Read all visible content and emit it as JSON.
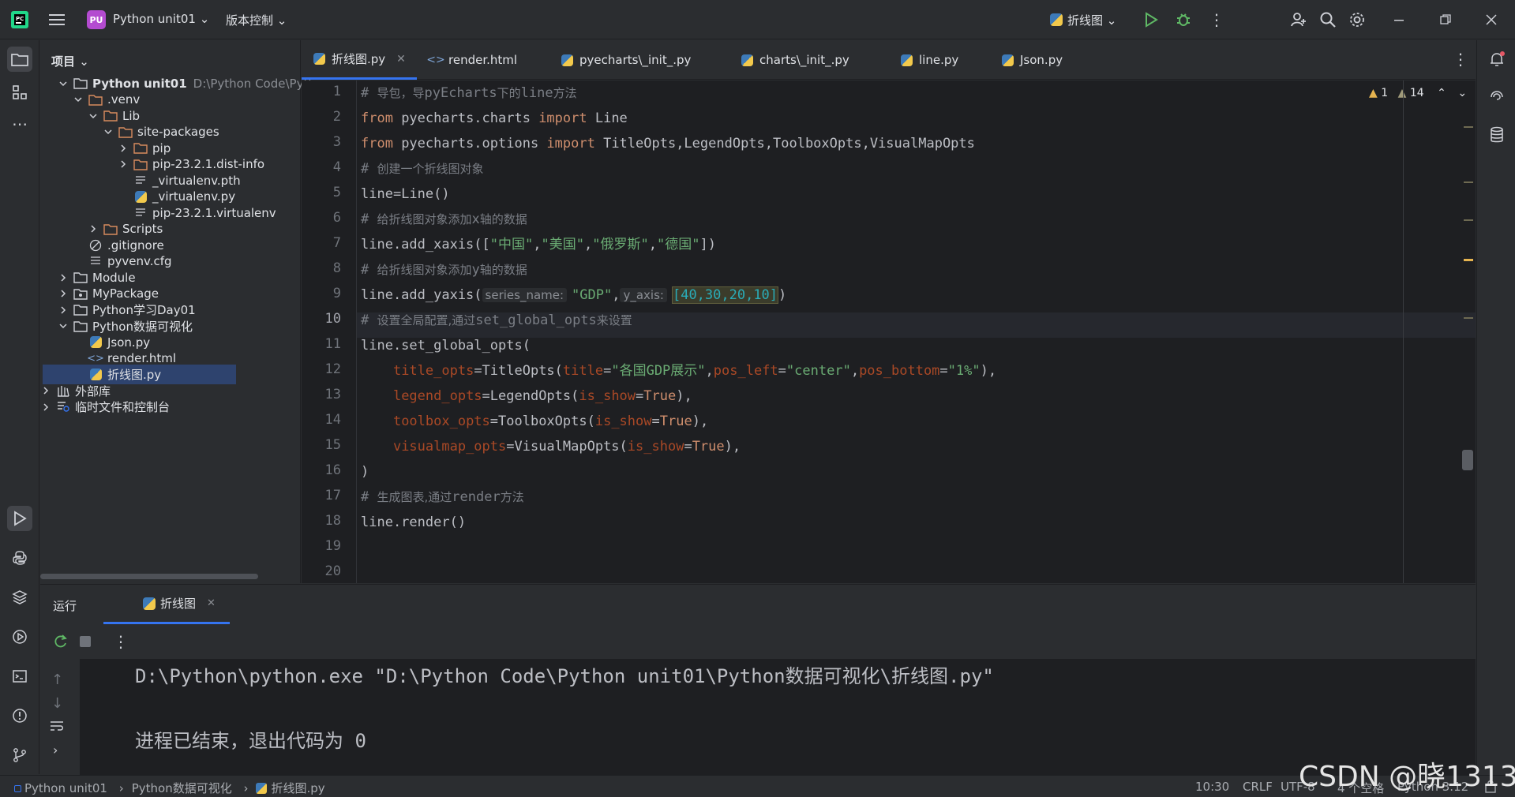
{
  "titlebar": {
    "project_badge": "PU",
    "project_name": "Python unit01",
    "vcs": "版本控制",
    "run_config": "折线图"
  },
  "project_panel": {
    "title": "项目",
    "tree": [
      {
        "label": "Python unit01",
        "hint": "D:\\Python Code\\Pytho",
        "icon": "folder-icon",
        "expanded": true,
        "bold": true
      },
      {
        "label": ".venv",
        "icon": "folder-icon",
        "expanded": true
      },
      {
        "label": "Lib",
        "icon": "folder-icon",
        "expanded": true
      },
      {
        "label": "site-packages",
        "icon": "folder-icon",
        "expanded": true
      },
      {
        "label": "pip",
        "icon": "folder-icon",
        "expanded": false
      },
      {
        "label": "pip-23.2.1.dist-info",
        "icon": "folder-icon",
        "expanded": false
      },
      {
        "label": "_virtualenv.pth",
        "icon": "text-file-icon"
      },
      {
        "label": "_virtualenv.py",
        "icon": "python-file-icon"
      },
      {
        "label": "pip-23.2.1.virtualenv",
        "icon": "text-file-icon"
      },
      {
        "label": "Scripts",
        "icon": "folder-icon",
        "expanded": false
      },
      {
        "label": ".gitignore",
        "icon": "ignore-file-icon"
      },
      {
        "label": "pyvenv.cfg",
        "icon": "config-file-icon"
      },
      {
        "label": "Module",
        "icon": "folder-icon",
        "expanded": false
      },
      {
        "label": "MyPackage",
        "icon": "package-icon",
        "expanded": false
      },
      {
        "label": "Python学习Day01",
        "icon": "folder-icon",
        "expanded": false
      },
      {
        "label": "Python数据可视化",
        "icon": "folder-icon",
        "expanded": true
      },
      {
        "label": "Json.py",
        "icon": "python-file-icon"
      },
      {
        "label": "render.html",
        "icon": "html-file-icon"
      },
      {
        "label": "折线图.py",
        "icon": "python-file-icon",
        "selected": true
      },
      {
        "label": "外部库",
        "icon": "library-icon",
        "expanded": false
      },
      {
        "label": "临时文件和控制台",
        "icon": "scratch-icon",
        "expanded": false
      }
    ]
  },
  "tabs": [
    {
      "label": "折线图.py",
      "icon": "python-file-icon",
      "active": true
    },
    {
      "label": "render.html",
      "icon": "html-file-icon"
    },
    {
      "label": "pyecharts\\_init_.py",
      "icon": "python-file-icon"
    },
    {
      "label": "charts\\_init_.py",
      "icon": "python-file-icon"
    },
    {
      "label": "line.py",
      "icon": "python-file-icon"
    },
    {
      "label": "Json.py",
      "icon": "python-file-icon"
    }
  ],
  "editor": {
    "warnings": "1",
    "weak_warnings": "14",
    "current_line": 10,
    "line_numbers": [
      "1",
      "2",
      "3",
      "4",
      "5",
      "6",
      "7",
      "8",
      "9",
      "10",
      "11",
      "12",
      "13",
      "14",
      "15",
      "16",
      "17",
      "18",
      "19",
      "20"
    ],
    "code": {
      "l1_comment_a": "# ",
      "l1_comment_b": "导包，导",
      "l1_comment_c": "pyEcharts",
      "l1_comment_d": "下的",
      "l1_comment_e": "line",
      "l1_comment_f": "方法",
      "l2_from": "from",
      "l2_module": " pyecharts.charts ",
      "l2_import": "import",
      "l2_name": " Line",
      "l3_from": "from",
      "l3_module": " pyecharts.options ",
      "l3_import": "import",
      "l3_names": " TitleOpts,LegendOpts,ToolboxOpts,VisualMapOpts",
      "l4_comment_a": "# ",
      "l4_comment_b": "创建一个折线图对象",
      "l5": "line=Line()",
      "l6_comment_a": "# ",
      "l6_comment_b": "给折线图对象添加",
      "l6_comment_c": "x",
      "l6_comment_d": "轴的数据",
      "l7_a": "line.add_xaxis([",
      "l7_s1": "\"中国\"",
      "l7_c1": ",",
      "l7_s2": "\"美国\"",
      "l7_c2": ",",
      "l7_s3": "\"俄罗斯\"",
      "l7_c3": ",",
      "l7_s4": "\"德国\"",
      "l7_b": "])",
      "l8_comment_a": "# ",
      "l8_comment_b": "给折线图对象添加",
      "l8_comment_c": "y",
      "l8_comment_d": "轴的数据",
      "l9_a": "line.add_yaxis(",
      "l9_hint1": "series_name:",
      "l9_s": "\"GDP\"",
      "l9_comma": ",",
      "l9_hint2": "y_axis:",
      "l9_list": "[40,30,20,10]",
      "l9_b": ")",
      "l10_comment_a": "# ",
      "l10_comment_b": "设置全局配置,通过",
      "l10_comment_c": "set_global_opts",
      "l10_comment_d": "来设置",
      "l11": "line.set_global_opts(",
      "l12_p1": "title_opts",
      "l12_a": "=TitleOpts(",
      "l12_p2": "title",
      "l12_eq": "=",
      "l12_s1": "\"各国GDP展示\"",
      "l12_c1": ",",
      "l12_p3": "pos_left",
      "l12_eq2": "=",
      "l12_s2": "\"center\"",
      "l12_c2": ",",
      "l12_p4": "pos_bottom",
      "l12_eq3": "=",
      "l12_s3": "\"1%\"",
      "l12_b": "),",
      "l13_p1": "legend_opts",
      "l13_a": "=LegendOpts(",
      "l13_p2": "is_show",
      "l13_eq": "=",
      "l13_v": "True",
      "l13_b": "),",
      "l14_p1": "toolbox_opts",
      "l14_a": "=ToolboxOpts(",
      "l14_p2": "is_show",
      "l14_eq": "=",
      "l14_v": "True",
      "l14_b": "),",
      "l15_p1": "visualmap_opts",
      "l15_a": "=VisualMapOpts(",
      "l15_p2": "is_show",
      "l15_eq": "=",
      "l15_v": "True",
      "l15_b": "),",
      "l16": ")",
      "l17_comment_a": "# ",
      "l17_comment_b": "生成图表,通过",
      "l17_comment_c": "render",
      "l17_comment_d": "方法",
      "l18": "line.render()"
    }
  },
  "run_panel": {
    "title": "运行",
    "tab_label": "折线图",
    "console_line1": "D:\\Python\\python.exe \"D:\\Python Code\\Python unit01\\Python数据可视化\\折线图.py\"",
    "console_line2": "进程已结束，退出代码为 0"
  },
  "statusbar": {
    "crumb1": "Python unit01",
    "crumb2": "Python数据可视化",
    "crumb3": "折线图.py",
    "position": "10:30",
    "line_sep": "CRLF",
    "encoding": "UTF-8",
    "indent": "4 个空格",
    "interpreter": "Python 3.12"
  },
  "watermark": "CSDN @晓1313",
  "colors": {
    "accent": "#3574f0",
    "keyword": "#cf8e6d",
    "string": "#6aab73",
    "param": "#aa4926",
    "number": "#2aacb8",
    "comment": "#7a7e85",
    "run_green": "#5fb865",
    "warning": "#e6b450"
  }
}
